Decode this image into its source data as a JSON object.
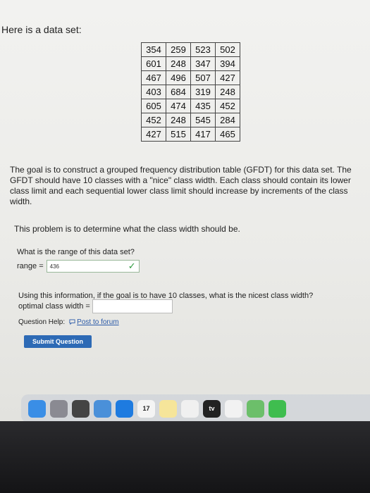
{
  "intro": "Here is a data set:",
  "table": [
    [
      "354",
      "259",
      "523",
      "502"
    ],
    [
      "601",
      "248",
      "347",
      "394"
    ],
    [
      "467",
      "496",
      "507",
      "427"
    ],
    [
      "403",
      "684",
      "319",
      "248"
    ],
    [
      "605",
      "474",
      "435",
      "452"
    ],
    [
      "452",
      "248",
      "545",
      "284"
    ],
    [
      "427",
      "515",
      "417",
      "465"
    ]
  ],
  "goal": "The goal is to construct a grouped frequency distribution table (GFDT) for this data set. The GFDT should have 10 classes with a \"nice\" class width. Each class should contain its lower class limit and each sequential lower class limit should increase by increments of the class width.",
  "problem": "This problem is to determine what the class width should be.",
  "q1": {
    "question": "What is the range of this data set?",
    "label": "range =",
    "value": "436",
    "status": "correct"
  },
  "q2": {
    "question": "Using this information, if the goal is to have 10 classes, what is the nicest class width?",
    "label": "optimal class width =",
    "value": ""
  },
  "help": {
    "label": "Question Help:",
    "link": "Post to forum"
  },
  "submit_label": "Submit Question",
  "dock": {
    "icons": [
      {
        "name": "finder-icon",
        "color": "#3a8ee6",
        "text": ""
      },
      {
        "name": "launchpad-icon",
        "color": "#8a8a92",
        "text": ""
      },
      {
        "name": "apps-grid-icon",
        "color": "#444",
        "text": ""
      },
      {
        "name": "mail-icon",
        "color": "#4a90d9",
        "text": ""
      },
      {
        "name": "safari-icon",
        "color": "#1e7be0",
        "text": ""
      },
      {
        "name": "calendar-icon",
        "color": "#f4f4f4",
        "text": "17"
      },
      {
        "name": "notes-icon",
        "color": "#f6e59a",
        "text": ""
      },
      {
        "name": "photos-icon",
        "color": "#f0f0f0",
        "text": ""
      },
      {
        "name": "appletv-icon",
        "color": "#222",
        "text": "tv"
      },
      {
        "name": "reminders-icon",
        "color": "#f2f2f2",
        "text": ""
      },
      {
        "name": "maps-icon",
        "color": "#6cbf6a",
        "text": ""
      },
      {
        "name": "facetime-icon",
        "color": "#3fbd4f",
        "text": ""
      }
    ],
    "calendar_day": "17",
    "tv_label": "tv"
  },
  "colors": {
    "submit_bg": "#2d6ab5",
    "link": "#2b5aa8",
    "check": "#2e9b3e"
  }
}
